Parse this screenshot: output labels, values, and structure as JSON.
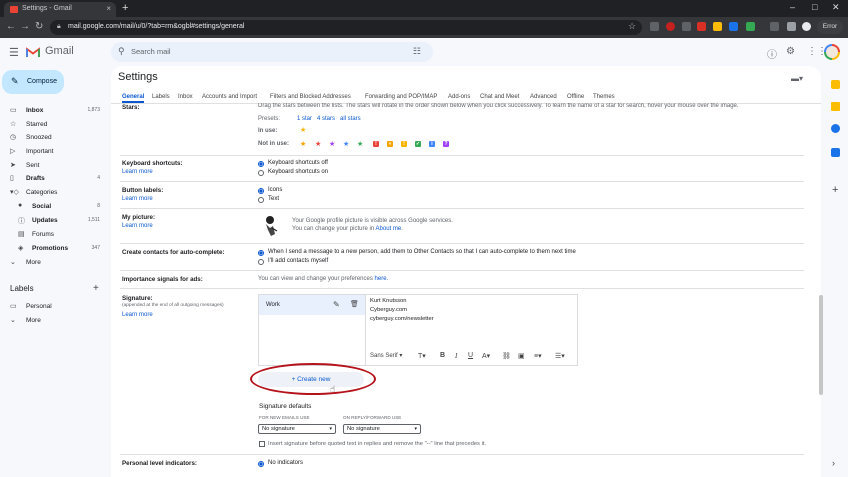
{
  "browser": {
    "tab_title": "Settings - Gmail",
    "new_tab": "+",
    "url": "mail.google.com/mail/u/0/?tab=rm&ogbl#settings/general",
    "error_label": "Error",
    "close_tab": "×",
    "minimize": "–",
    "maximize": "□",
    "close_window": "✕"
  },
  "gmail": {
    "app_name": "Gmail",
    "search_placeholder": "Search mail",
    "compose": "Compose",
    "nav": [
      {
        "label": "Inbox",
        "count": "1,873",
        "icon": "inbox-icon",
        "glyph": "▭",
        "bold": true
      },
      {
        "label": "Starred",
        "count": "",
        "icon": "star-icon",
        "glyph": "☆",
        "bold": false
      },
      {
        "label": "Snoozed",
        "count": "",
        "icon": "clock-icon",
        "glyph": "◷",
        "bold": false
      },
      {
        "label": "Important",
        "count": "",
        "icon": "important-icon",
        "glyph": "▷",
        "bold": false
      },
      {
        "label": "Sent",
        "count": "",
        "icon": "send-icon",
        "glyph": "➤",
        "bold": false
      },
      {
        "label": "Drafts",
        "count": "4",
        "icon": "draft-icon",
        "glyph": "▯",
        "bold": true
      },
      {
        "label": "Categories",
        "count": "",
        "icon": "category-icon",
        "glyph": "▾◇",
        "bold": false
      },
      {
        "label": "Social",
        "count": "8",
        "icon": "social-icon",
        "glyph": "●",
        "bold": true,
        "sub": true
      },
      {
        "label": "Updates",
        "count": "1,511",
        "icon": "updates-icon",
        "glyph": "ⓘ",
        "bold": true,
        "sub": true
      },
      {
        "label": "Forums",
        "count": "",
        "icon": "forums-icon",
        "glyph": "▤",
        "bold": false,
        "sub": true
      },
      {
        "label": "Promotions",
        "count": "347",
        "icon": "tag-icon",
        "glyph": "◈",
        "bold": true,
        "sub": true
      },
      {
        "label": "More",
        "count": "",
        "icon": "chevron-down-icon",
        "glyph": "⌄",
        "bold": false
      }
    ],
    "labels_heading": "Labels",
    "labels": [
      {
        "label": "Personal",
        "icon": "label-icon",
        "glyph": "▭"
      },
      {
        "label": "More",
        "icon": "chevron-down-icon",
        "glyph": "⌄"
      }
    ]
  },
  "settings": {
    "title": "Settings",
    "tabs": [
      "General",
      "Labels",
      "Inbox",
      "Accounts and Import",
      "Filters and Blocked Addresses",
      "Forwarding and POP/IMAP",
      "Add-ons",
      "Chat and Meet",
      "Advanced",
      "Offline",
      "Themes"
    ],
    "stars": {
      "label": "Stars:",
      "drag_text": "Drag the stars between the lists.  The stars will rotate in the order shown below when you click successively. To learn the name of a star for search, hover your mouse over the image.",
      "presets_label": "Presets:",
      "presets": [
        "1 star",
        "4 stars",
        "all stars"
      ],
      "in_use_label": "In use:",
      "not_in_use_label": "Not in use:"
    },
    "keyboard": {
      "label": "Keyboard shortcuts:",
      "learn": "Learn more",
      "opt_off": "Keyboard shortcuts off",
      "opt_on": "Keyboard shortcuts on"
    },
    "button_labels": {
      "label": "Button labels:",
      "learn": "Learn more",
      "opt_icons": "Icons",
      "opt_text": "Text"
    },
    "picture": {
      "label": "My picture:",
      "learn": "Learn more",
      "line1": "Your Google profile picture is visible across Google services.",
      "line2_pre": "You can change your picture in ",
      "line2_link": "About me",
      "line2_post": "."
    },
    "contacts": {
      "label": "Create contacts for auto-complete:",
      "opt1": "When I send a message to a new person, add them to Other Contacts so that I can auto-complete to them next time",
      "opt2": "I'll add contacts myself"
    },
    "importance": {
      "label": "Importance signals for ads:",
      "text_pre": "You can view and change your preferences ",
      "text_link": "here",
      "text_post": "."
    },
    "signature": {
      "label": "Signature:",
      "note": "(appended at the end of all outgoing messages)",
      "learn": "Learn more",
      "item": "Work",
      "lines": [
        "Kurt Knutsson",
        "Cyberguy.com",
        "cyberguy.com/newsletter"
      ],
      "font": "Sans Serif",
      "create_new": "Create new",
      "defaults_heading": "Signature defaults",
      "new_emails_label": "FOR NEW EMAILS USE",
      "reply_label": "ON REPLY/FORWARD USE",
      "new_emails_value": "No signature",
      "reply_value": "No signature",
      "insert_text": "Insert signature before quoted text in replies and remove the \"--\" line that precedes it."
    },
    "personal": {
      "label": "Personal level indicators:",
      "opt1": "No indicators"
    }
  }
}
